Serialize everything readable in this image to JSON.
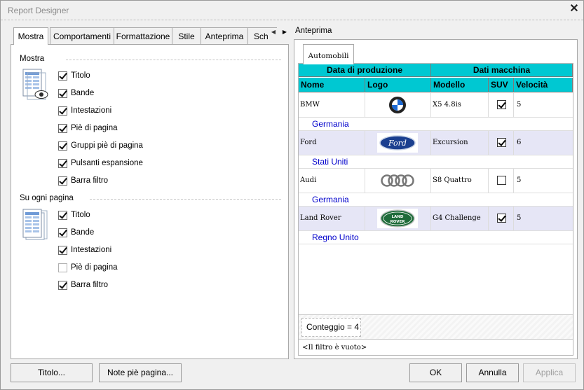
{
  "window": {
    "title": "Report Designer"
  },
  "left_tabs": [
    "Mostra",
    "Comportamenti",
    "Formattazione",
    "Stile",
    "Anteprima",
    "Sch"
  ],
  "mostra_section": {
    "label": "Mostra",
    "items": [
      {
        "label": "Titolo",
        "checked": true
      },
      {
        "label": "Bande",
        "checked": true
      },
      {
        "label": "Intestazioni",
        "checked": true
      },
      {
        "label": "Piè di pagina",
        "checked": true
      },
      {
        "label": "Gruppi piè di pagina",
        "checked": true
      },
      {
        "label": "Pulsanti espansione",
        "checked": true
      },
      {
        "label": "Barra filtro",
        "checked": true
      }
    ]
  },
  "every_page_section": {
    "label": "Su ogni pagina",
    "items": [
      {
        "label": "Titolo",
        "checked": true
      },
      {
        "label": "Bande",
        "checked": true
      },
      {
        "label": "Intestazioni",
        "checked": true
      },
      {
        "label": "Piè di pagina",
        "checked": false
      },
      {
        "label": "Barra filtro",
        "checked": true
      }
    ]
  },
  "preview": {
    "title": "Anteprima",
    "inner_tab": "Automobili",
    "bands": [
      "Data di produzione",
      "Dati macchina"
    ],
    "headers": [
      "Nome",
      "Logo",
      "Modello",
      "SUV",
      "Velocità"
    ],
    "rows": [
      {
        "nome": "BMW",
        "logo": "bmw-logo",
        "modello": "X5 4.8is",
        "suv": true,
        "velocita": "5",
        "group": "Germania"
      },
      {
        "nome": "Ford",
        "logo": "ford-logo",
        "modello": "Excursion",
        "suv": true,
        "velocita": "6",
        "group": "Stati Uniti"
      },
      {
        "nome": "Audi",
        "logo": "audi-logo",
        "modello": "S8 Quattro",
        "suv": false,
        "velocita": "5",
        "group": "Germania"
      },
      {
        "nome": "Land Rover",
        "logo": "land-rover-logo",
        "modello": "G4 Challenge",
        "suv": true,
        "velocita": "5",
        "group": "Regno Unito"
      }
    ],
    "summary": "Conteggio = 4",
    "filter_status": "<Il filtro è vuoto>"
  },
  "buttons": {
    "title": "Titolo...",
    "footer_notes": "Note piè pagina...",
    "ok": "OK",
    "cancel": "Annulla",
    "apply": "Applica"
  },
  "colors": {
    "band_bg": "#00c8d2",
    "alt_row_bg": "#e6e6f6",
    "group_text": "#0000cc"
  }
}
